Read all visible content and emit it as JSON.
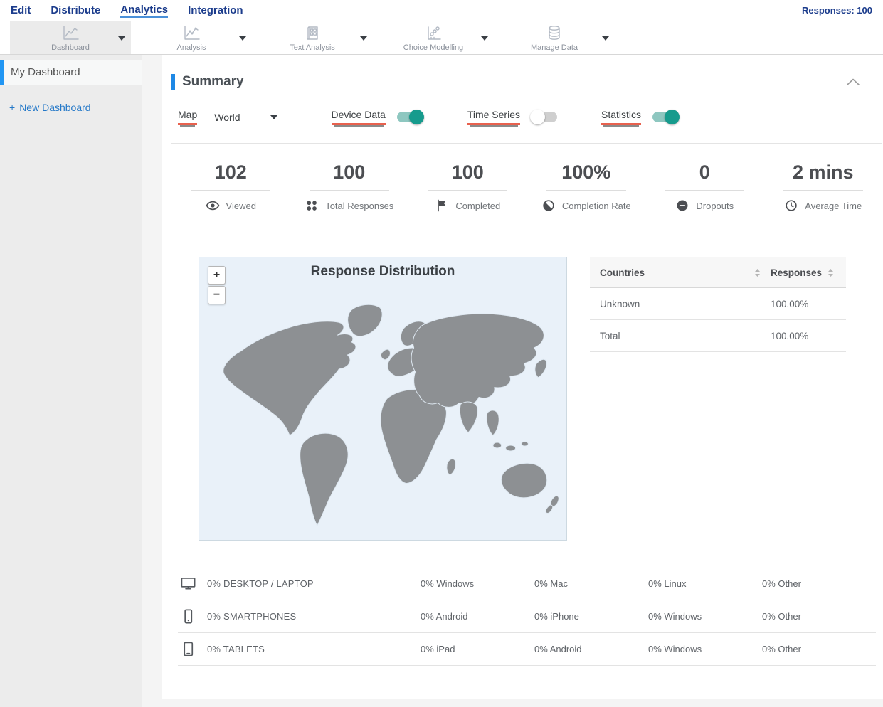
{
  "top_nav": {
    "items": [
      {
        "label": "Edit"
      },
      {
        "label": "Distribute"
      },
      {
        "label": "Analytics"
      },
      {
        "label": "Integration"
      }
    ],
    "active": "Analytics",
    "responses": "Responses: 100"
  },
  "toolbar": {
    "items": [
      {
        "label": "Dashboard",
        "icon": "line-chart-icon",
        "active": true
      },
      {
        "label": "Analysis",
        "icon": "line-chart-points-icon",
        "active": false
      },
      {
        "label": "Text Analysis",
        "icon": "document-grid-icon",
        "active": false
      },
      {
        "label": "Choice Modelling",
        "icon": "scatter-chart-icon",
        "active": false
      },
      {
        "label": "Manage Data",
        "icon": "database-icon",
        "active": false
      }
    ]
  },
  "sidebar": {
    "items": [
      {
        "label": "My Dashboard",
        "active": true
      }
    ],
    "new_dashboard": {
      "plus": "+",
      "label": "New Dashboard"
    }
  },
  "summary": {
    "title": "Summary",
    "controls": {
      "map_label": "Map",
      "map_value": "World",
      "device_data_label": "Device Data",
      "time_series_label": "Time Series",
      "statistics_label": "Statistics",
      "toggles": {
        "device_data": true,
        "time_series": false,
        "statistics": true
      }
    },
    "stats": [
      {
        "value": "102",
        "label": "Viewed",
        "icon": "eye"
      },
      {
        "value": "100",
        "label": "Total Responses",
        "icon": "dots-grid"
      },
      {
        "value": "100",
        "label": "Completed",
        "icon": "flag"
      },
      {
        "value": "100%",
        "label": "Completion Rate",
        "icon": "contrast-circle"
      },
      {
        "value": "0",
        "label": "Dropouts",
        "icon": "minus-circle"
      },
      {
        "value": "2 mins",
        "label": "Average Time",
        "icon": "clock"
      }
    ],
    "map_panel": {
      "title": "Response Distribution",
      "zoom_in": "+",
      "zoom_out": "−"
    },
    "countries_table": {
      "col_countries": "Countries",
      "col_responses": "Responses",
      "rows": [
        {
          "country": "Unknown",
          "responses": "100.00%"
        },
        {
          "country": "Total",
          "responses": "100.00%"
        }
      ]
    },
    "devices": [
      {
        "icon": "desktop",
        "label": "0% DESKTOP / LAPTOP",
        "cols": [
          "0% Windows",
          "0% Mac",
          "0% Linux",
          "0% Other"
        ]
      },
      {
        "icon": "smartphone",
        "label": "0% SMARTPHONES",
        "cols": [
          "0% Android",
          "0% iPhone",
          "0% Windows",
          "0% Other"
        ]
      },
      {
        "icon": "tablet",
        "label": "0% TABLETS",
        "cols": [
          "0% iPad",
          "0% Android",
          "0% Windows",
          "0% Other"
        ]
      }
    ]
  },
  "colors": {
    "nav_blue": "#1b3c8c",
    "accent_blue": "#1e88e5",
    "active_indicator_blue": "#2196f3",
    "link_blue": "#2478c8",
    "toggle_teal": "#169b8d",
    "underline_red": "#e8614e",
    "map_bg": "#e9f1f9",
    "country_gray": "#8d9093"
  }
}
